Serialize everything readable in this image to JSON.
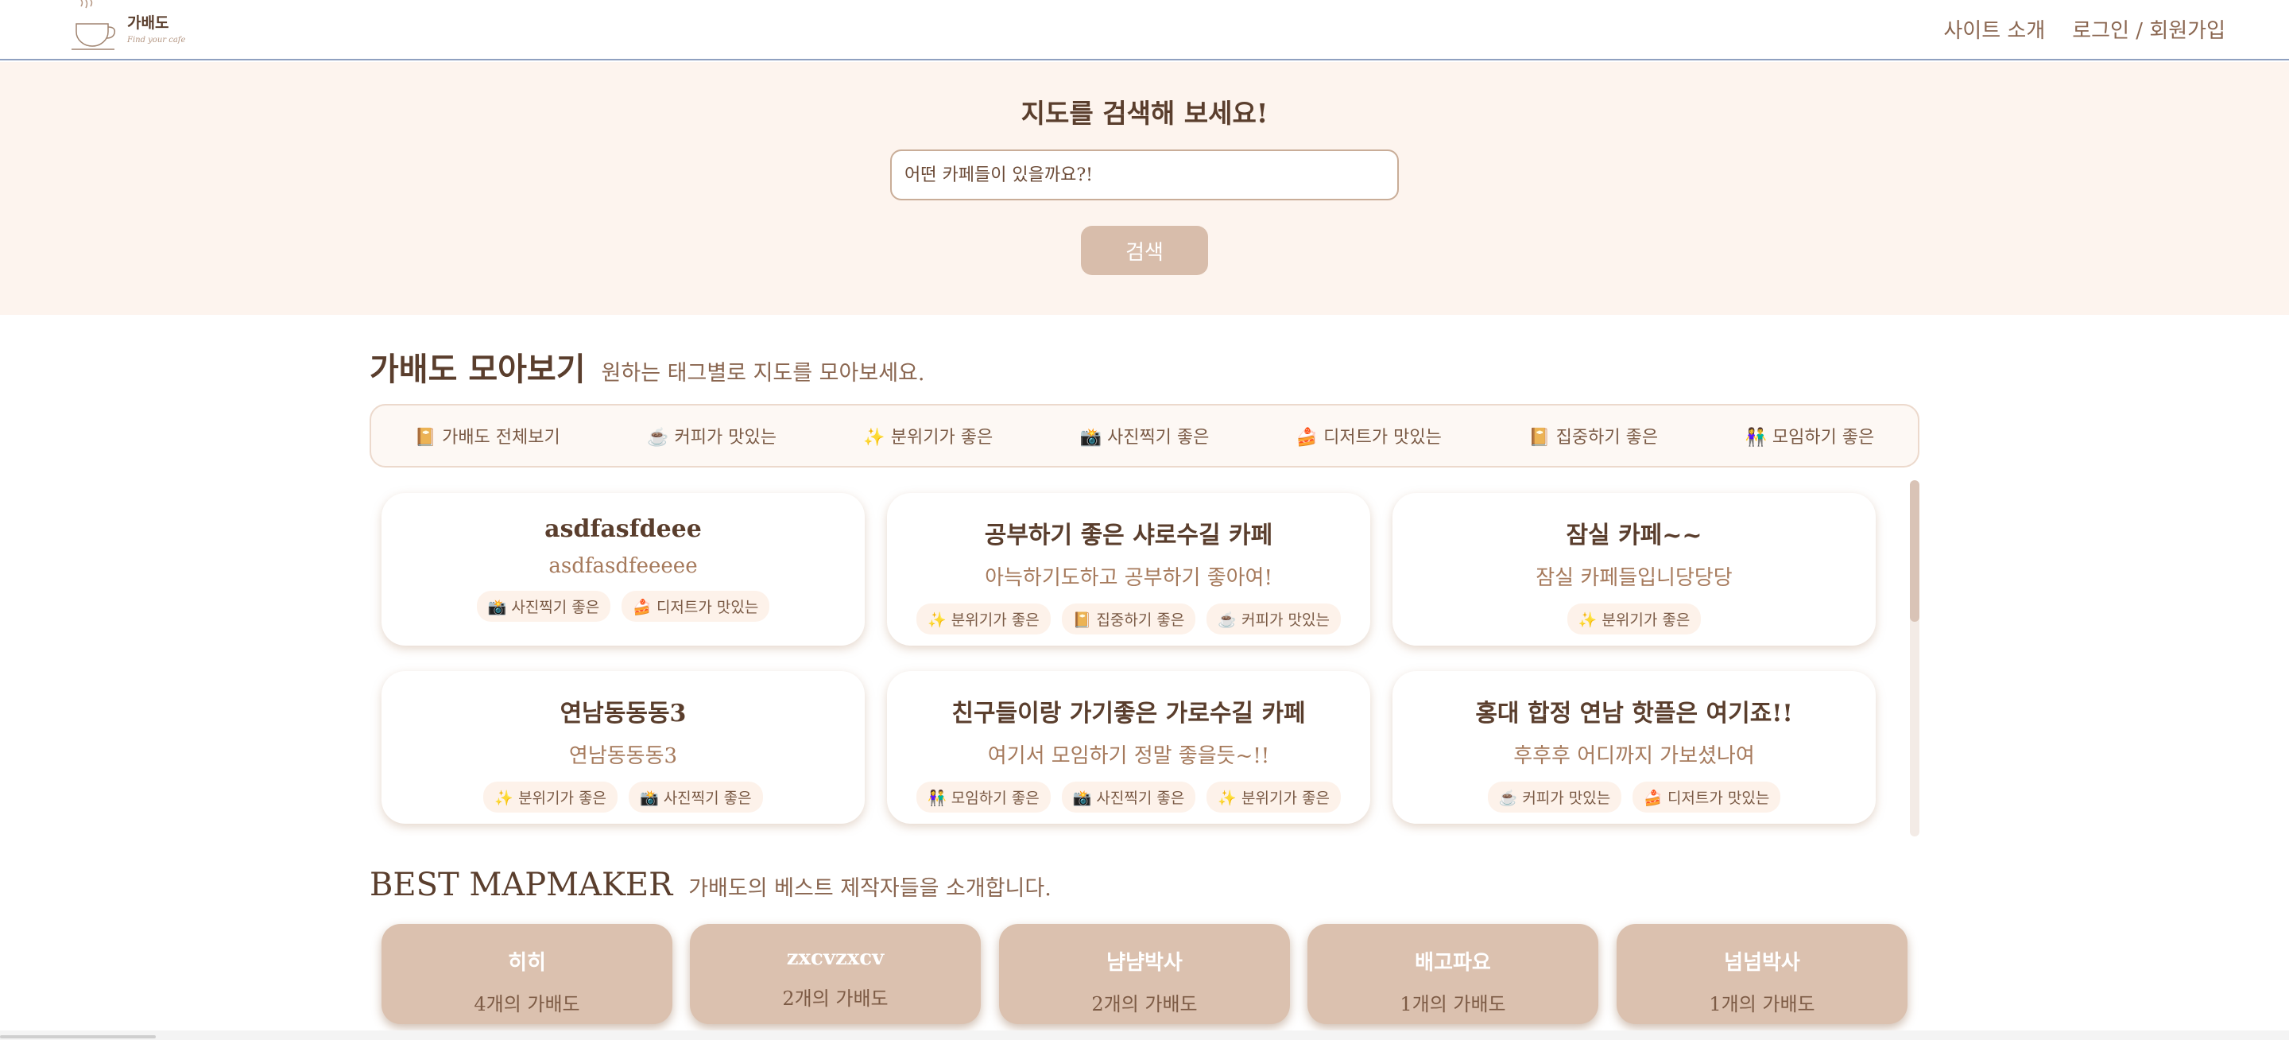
{
  "header": {
    "logo_title": "가배도",
    "logo_sub": "Find your cafe",
    "nav": [
      "사이트 소개",
      "로그인 / 회원가입"
    ]
  },
  "hero": {
    "title": "지도를 검색해 보세요!",
    "search_placeholder": "어떤 카페들이 있을까요?!",
    "search_button": "검색"
  },
  "collection": {
    "title": "가배도 모아보기",
    "subtitle": "원하는 태그별로 지도를 모아보세요.",
    "tags": [
      "📔 가배도 전체보기",
      "☕ 커피가 맛있는",
      "✨ 분위기가 좋은",
      "📸 사진찍기 좋은",
      "🍰 디저트가 맛있는",
      "📔 집중하기 좋은",
      "👫 모임하기 좋은"
    ]
  },
  "cards": [
    {
      "title": "asdfasfdeee",
      "desc": "asdfasdfeeeee",
      "tags": [
        "📸 사진찍기 좋은",
        "🍰 디저트가 맛있는"
      ]
    },
    {
      "title": "공부하기 좋은 샤로수길 카페",
      "desc": "아늑하기도하고 공부하기 좋아여!",
      "tags": [
        "✨ 분위기가 좋은",
        "📔 집중하기 좋은",
        "☕ 커피가 맛있는"
      ]
    },
    {
      "title": "잠실 카페~~",
      "desc": "잠실 카페들입니당당당",
      "tags": [
        "✨ 분위기가 좋은"
      ]
    },
    {
      "title": "연남동동동3",
      "desc": "연남동동동3",
      "tags": [
        "✨ 분위기가 좋은",
        "📸 사진찍기 좋은"
      ]
    },
    {
      "title": "친구들이랑 가기좋은 가로수길 카페",
      "desc": "여기서 모임하기 정말 좋을듯~!!",
      "tags": [
        "👫 모임하기 좋은",
        "📸 사진찍기 좋은",
        "✨ 분위기가 좋은"
      ]
    },
    {
      "title": "홍대 합정 연남 핫플은 여기죠!!",
      "desc": "후후후 어디까지 가보셨나여",
      "tags": [
        "☕ 커피가 맛있는",
        "🍰 디저트가 맛있는"
      ]
    }
  ],
  "best": {
    "title": "BEST MAPMAKER",
    "subtitle": "가배도의 베스트 제작자들을 소개합니다.",
    "makers": [
      {
        "name": "히히",
        "count": "4개의 가배도"
      },
      {
        "name": "zxcvzxcv",
        "count": "2개의 가배도"
      },
      {
        "name": "냠냠박사",
        "count": "2개의 가배도"
      },
      {
        "name": "배고파요",
        "count": "1개의 가배도"
      },
      {
        "name": "넘넘박사",
        "count": "1개의 가배도"
      }
    ]
  }
}
